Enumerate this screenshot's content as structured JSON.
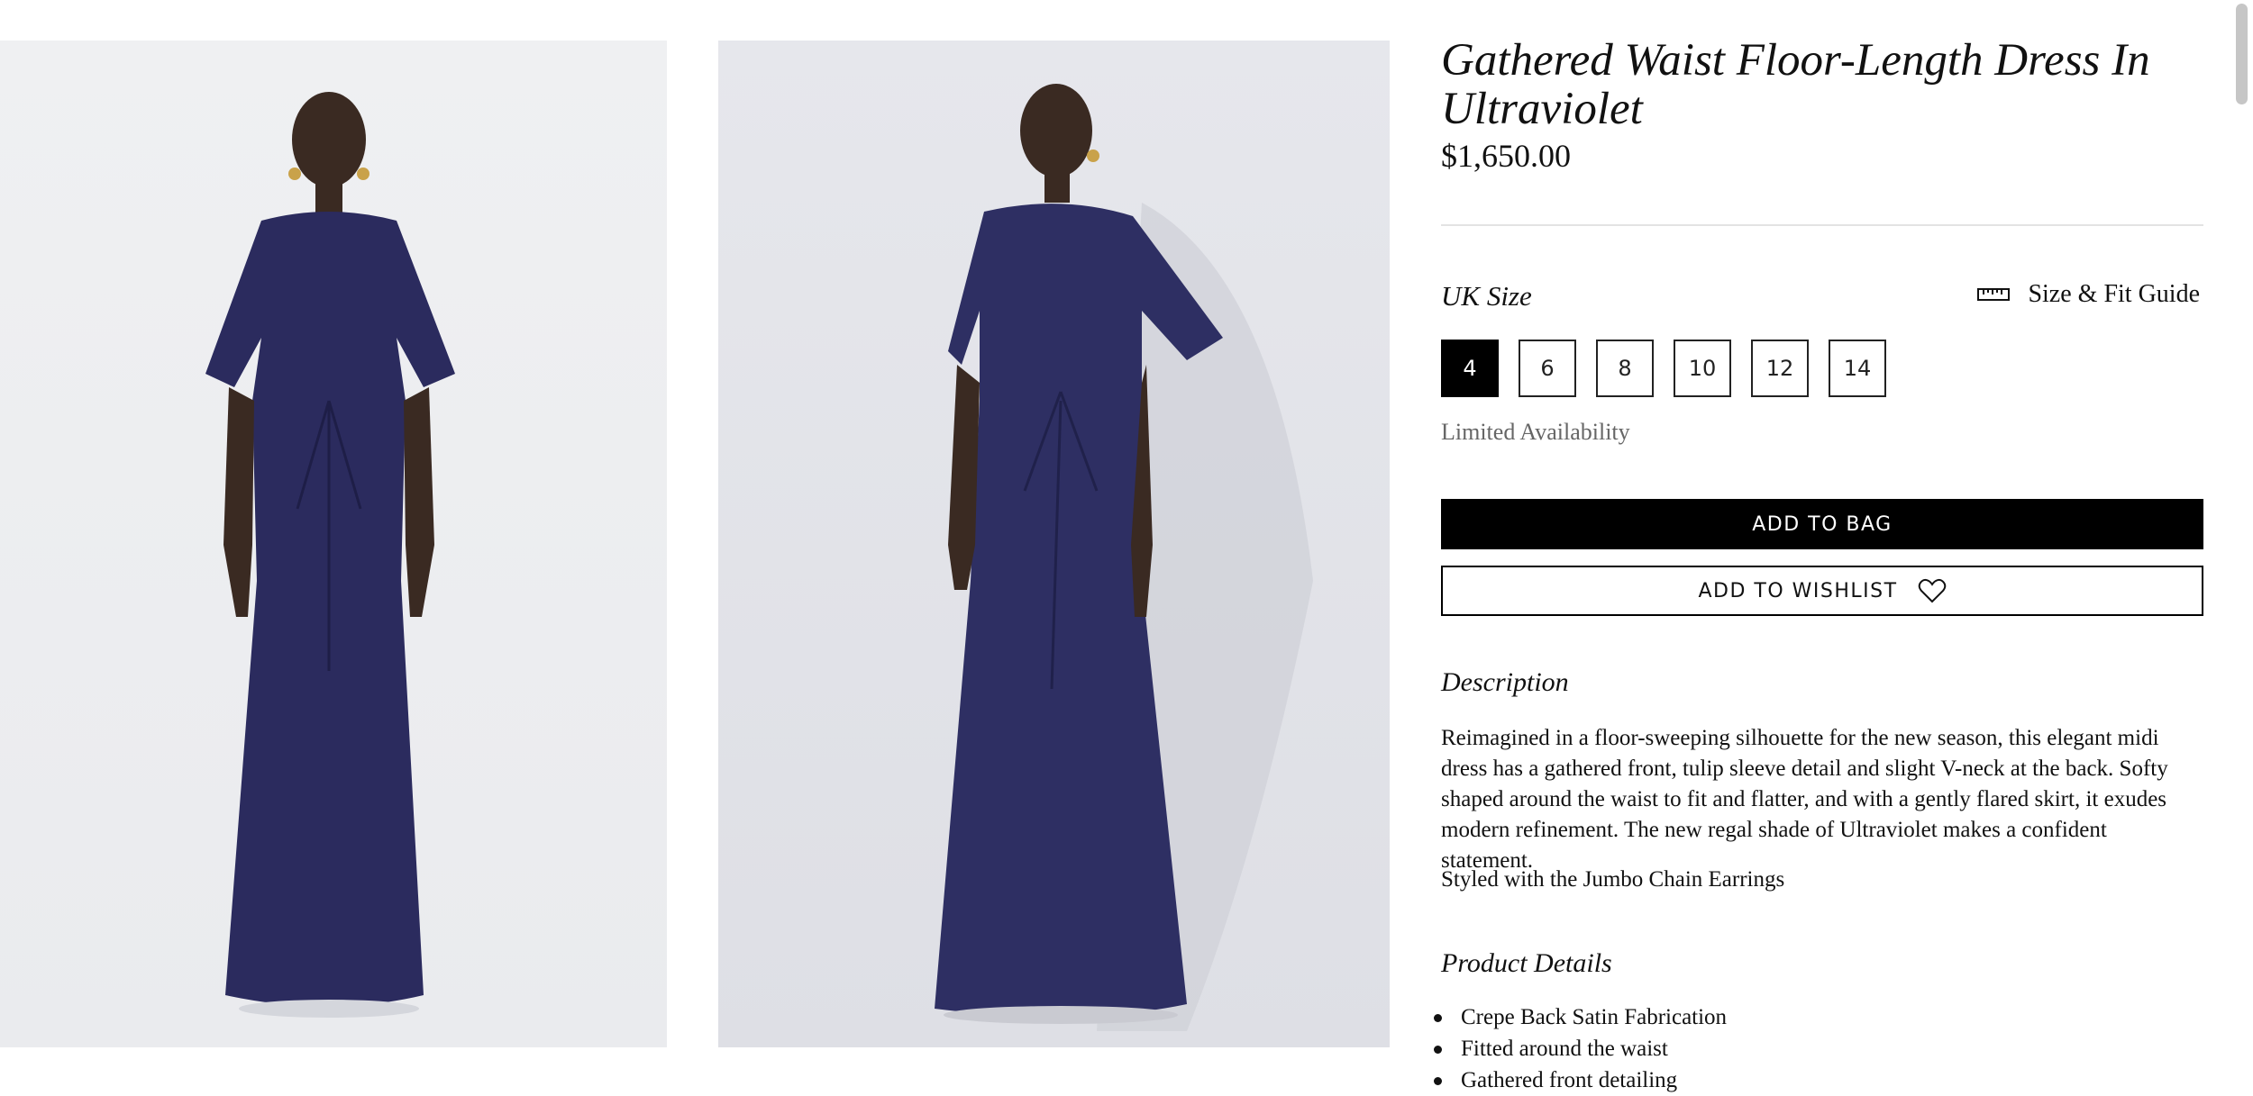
{
  "gallery": {
    "images": [
      {
        "name": "model-front-view",
        "dress_color": "#2b2b5e"
      },
      {
        "name": "model-angled-view",
        "dress_color": "#2e2f63"
      }
    ]
  },
  "product": {
    "title": "Gathered Waist Floor-Length Dress In Ultraviolet",
    "price": "$1,650.00"
  },
  "size": {
    "label": "UK Size",
    "fit_guide_label": "Size & Fit Guide",
    "fit_guide_icon": "ruler-icon",
    "options": [
      "4",
      "6",
      "8",
      "10",
      "12",
      "14"
    ],
    "selected": "4",
    "availability": "Limited Availability"
  },
  "actions": {
    "add_to_bag": "ADD TO BAG",
    "add_to_wishlist": "ADD TO WISHLIST",
    "wishlist_icon": "heart-icon"
  },
  "description": {
    "heading": "Description",
    "text": "Reimagined in a floor-sweeping silhouette for the new season, this elegant midi dress has a gathered front, tulip sleeve detail and slight V-neck at the back. Softy shaped around the waist to fit and flatter, and with a gently flared skirt, it exudes modern refinement. The new regal shade of Ultraviolet makes a confident statement.",
    "styled_with": "Styled with the Jumbo Chain Earrings"
  },
  "details": {
    "heading": "Product Details",
    "items": [
      "Crepe Back Satin Fabrication",
      "Fitted around the waist",
      "Gathered front detailing"
    ]
  },
  "colors": {
    "accent": "#000000",
    "muted_text": "#666666",
    "divider": "#e3e3e3"
  }
}
